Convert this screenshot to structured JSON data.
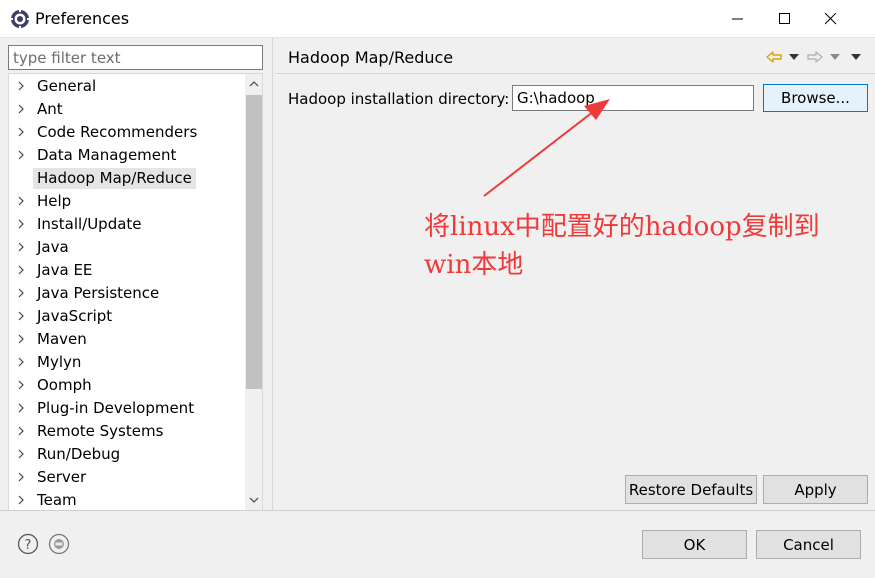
{
  "window": {
    "title": "Preferences",
    "icon": "eclipse-gear-icon"
  },
  "filter": {
    "placeholder": "type filter text",
    "value": ""
  },
  "tree": {
    "items": [
      {
        "label": "General"
      },
      {
        "label": "Ant"
      },
      {
        "label": "Code Recommenders"
      },
      {
        "label": "Data Management"
      },
      {
        "label": "Hadoop Map/Reduce",
        "selected": true
      },
      {
        "label": "Help"
      },
      {
        "label": "Install/Update"
      },
      {
        "label": "Java"
      },
      {
        "label": "Java EE"
      },
      {
        "label": "Java Persistence"
      },
      {
        "label": "JavaScript"
      },
      {
        "label": "Maven"
      },
      {
        "label": "Mylyn"
      },
      {
        "label": "Oomph"
      },
      {
        "label": "Plug-in Development"
      },
      {
        "label": "Remote Systems"
      },
      {
        "label": "Run/Debug"
      },
      {
        "label": "Server"
      },
      {
        "label": "Team"
      }
    ]
  },
  "page": {
    "title": "Hadoop Map/Reduce",
    "dir_label": "Hadoop installation directory:",
    "dir_value": "G:\\hadoop",
    "browse_label": "Browse...",
    "restore_label": "Restore Defaults",
    "apply_label": "Apply"
  },
  "annotation": {
    "line1": "将linux中配置好的hadoop复制到",
    "line2": "win本地",
    "color": "#f03a3a"
  },
  "footer": {
    "ok_label": "OK",
    "cancel_label": "Cancel"
  },
  "colors": {
    "accent": "#0078d7",
    "selection": "#e5e5e5",
    "nav_arrow": "#d9a400"
  }
}
